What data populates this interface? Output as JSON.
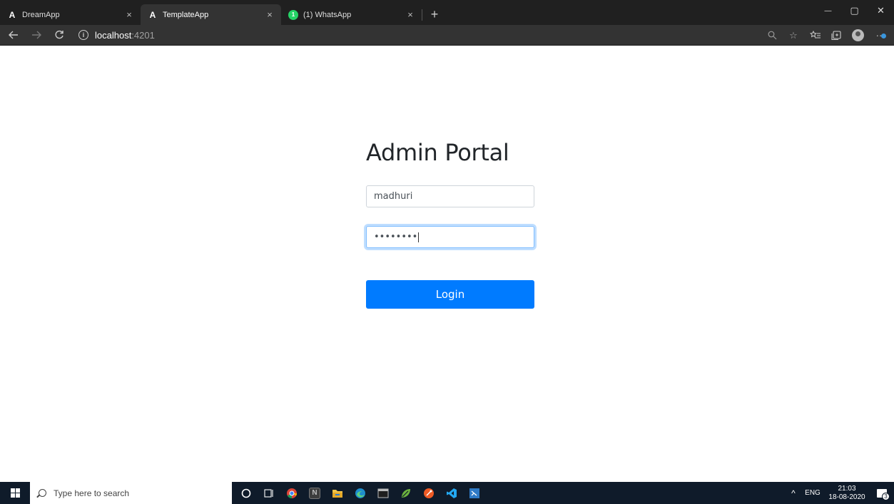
{
  "browser": {
    "tabs": [
      {
        "favicon": "A",
        "title": "DreamApp",
        "active": false
      },
      {
        "favicon": "A",
        "title": "TemplateApp",
        "active": true
      },
      {
        "favicon": "1",
        "title": "(1) WhatsApp",
        "active": false
      }
    ],
    "close_glyph": "×",
    "new_tab_glyph": "+",
    "window_controls": {
      "minimize": "—",
      "maximize": "▢",
      "close": "✕"
    },
    "address": {
      "host": "localhost",
      "port": ":4201"
    },
    "icons": [
      "search-icon",
      "star-icon",
      "favorites-icon",
      "collections-icon",
      "profile-icon",
      "more-icon"
    ]
  },
  "page": {
    "title": "Admin Portal",
    "username_value": "madhuri",
    "password_value": "••••••••",
    "login_label": "Login",
    "accent_color": "#007bff"
  },
  "taskbar": {
    "search_placeholder": "Type here to search",
    "tray": {
      "chevron": "^",
      "language": "ENG",
      "time": "21:03",
      "date": "18-08-2020",
      "notification_count": "3"
    }
  }
}
